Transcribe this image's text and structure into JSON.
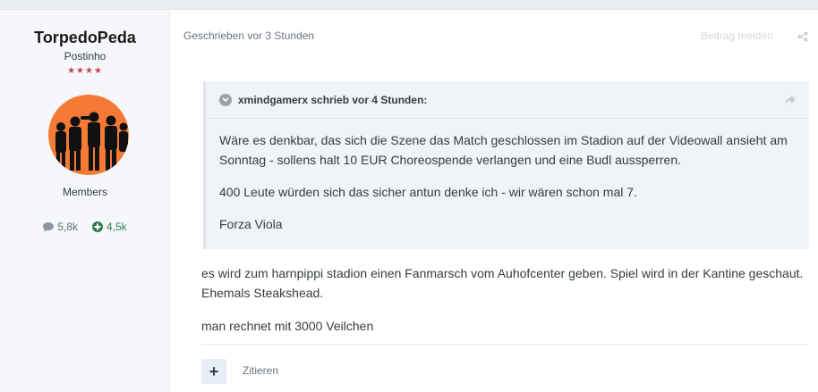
{
  "author": {
    "name": "TorpedoPeda",
    "title": "Postinho",
    "stars": "★★★★",
    "group": "Members",
    "posts_count": "5,8k",
    "reputation": "4,5k"
  },
  "post": {
    "meta": "Geschrieben vor 3 Stunden",
    "report_label": "Beitrag melden",
    "quote": {
      "header": "xmindgamerx schrieb vor 4 Stunden:",
      "paragraphs": [
        "Wäre es denkbar, das sich die Szene das Match geschlossen im Stadion auf der Videowall ansieht am Sonntag - sollens halt 10 EUR Choreospende verlangen und eine Budl aussperren.",
        "400 Leute würden sich das sicher antun denke ich - wir wären schon mal 7.",
        "Forza Viola"
      ]
    },
    "paragraphs": [
      "es wird zum harnpippi stadion einen Fanmarsch vom Auhofcenter geben. Spiel wird in der Kantine geschaut. Ehemals Steakshead.",
      "man rechnet mit 3000 Veilchen"
    ],
    "multiquote_label": "+",
    "quote_label": "Zitieren"
  },
  "icons": {
    "share": "share-icon",
    "comment": "comment-icon",
    "plus_circle": "plus-circle-icon",
    "chevron": "chevron-down-icon",
    "reply_arrow": "reply-arrow-icon"
  },
  "colors": {
    "accent_bg": "#f5f7fa",
    "quote_bg": "#f0f3f7",
    "avatar_bg": "#f47a35",
    "stars": "#b94a4a",
    "reputation": "#2e7d4f"
  }
}
